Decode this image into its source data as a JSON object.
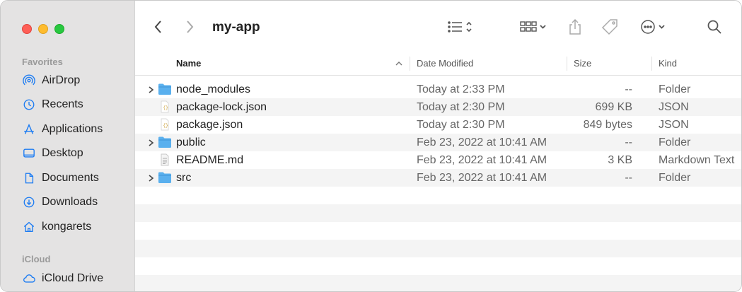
{
  "window": {
    "title": "my-app"
  },
  "sidebar": {
    "favorites_label": "Favorites",
    "favorites": [
      {
        "label": "AirDrop",
        "icon": "airdrop-icon"
      },
      {
        "label": "Recents",
        "icon": "clock-icon"
      },
      {
        "label": "Applications",
        "icon": "applications-icon"
      },
      {
        "label": "Desktop",
        "icon": "desktop-icon"
      },
      {
        "label": "Documents",
        "icon": "document-icon"
      },
      {
        "label": "Downloads",
        "icon": "download-icon"
      },
      {
        "label": "kongarets",
        "icon": "home-icon"
      }
    ],
    "icloud_label": "iCloud",
    "icloud": [
      {
        "label": "iCloud Drive",
        "icon": "cloud-icon"
      }
    ]
  },
  "columns": {
    "name": "Name",
    "date": "Date Modified",
    "size": "Size",
    "kind": "Kind"
  },
  "files": [
    {
      "name": "node_modules",
      "date": "Today at 2:33 PM",
      "size": "--",
      "kind": "Folder",
      "type": "folder"
    },
    {
      "name": "package-lock.json",
      "date": "Today at 2:30 PM",
      "size": "699 KB",
      "kind": "JSON",
      "type": "json"
    },
    {
      "name": "package.json",
      "date": "Today at 2:30 PM",
      "size": "849 bytes",
      "kind": "JSON",
      "type": "json"
    },
    {
      "name": "public",
      "date": "Feb 23, 2022 at 10:41 AM",
      "size": "--",
      "kind": "Folder",
      "type": "folder"
    },
    {
      "name": "README.md",
      "date": "Feb 23, 2022 at 10:41 AM",
      "size": "3 KB",
      "kind": "Markdown Text",
      "type": "text"
    },
    {
      "name": "src",
      "date": "Feb 23, 2022 at 10:41 AM",
      "size": "--",
      "kind": "Folder",
      "type": "folder"
    }
  ],
  "colors": {
    "folder": "#5ab0ee",
    "accent": "#1d7cf2",
    "traffic_red": "#fe5f57",
    "traffic_yellow": "#febc2e",
    "traffic_green": "#28c840"
  }
}
